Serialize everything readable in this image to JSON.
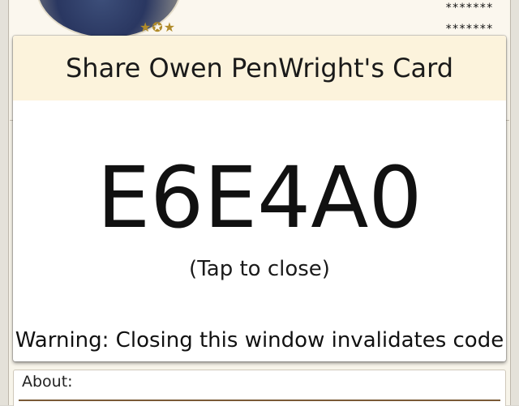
{
  "profile": {
    "masked_line_1": "*******",
    "masked_line_2": "*******",
    "badge_icon": "stars-badge-icon"
  },
  "modal": {
    "title": "Share Owen PenWright's Card",
    "code": "E6E4A0",
    "tap_hint": "(Tap to close)",
    "warning": "Warning: Closing this window invalidates code"
  },
  "about": {
    "label": "About:"
  },
  "colors": {
    "header_bg": "#fcf3dc",
    "page_bg": "#f7f4ea",
    "about_rule": "#7a5a36"
  }
}
